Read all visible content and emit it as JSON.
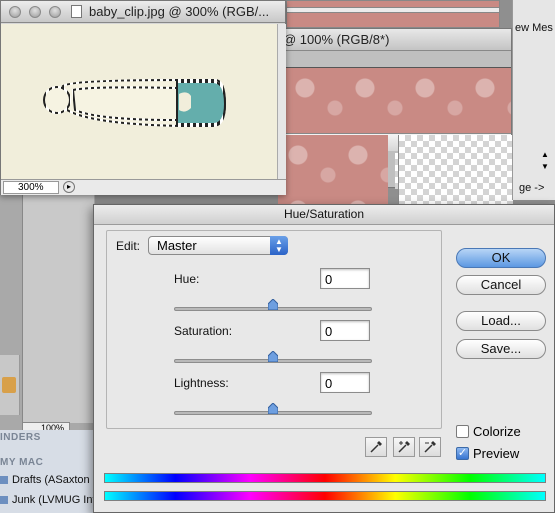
{
  "baby_window": {
    "title": "baby_clip.jpg @ 300% (RGB/...",
    "zoom": "300%"
  },
  "window_100": {
    "title": "@ 100% (RGB/8*)"
  },
  "top_right_panel": {
    "label_top": "ew Mes",
    "label_bottom": "ge ->"
  },
  "left_panel": {
    "zoom": "100%",
    "heading_finders": "INDERS",
    "heading_my_mac": "MY MAC",
    "mailboxes": [
      "Drafts (ASaxton",
      "Junk (LVMUG Inf"
    ]
  },
  "dialog": {
    "title": "Hue/Saturation",
    "edit_label": "Edit:",
    "edit_value": "Master",
    "sliders": [
      {
        "label": "Hue:",
        "value": "0",
        "level": 0.5
      },
      {
        "label": "Saturation:",
        "value": "0",
        "level": 0.5
      },
      {
        "label": "Lightness:",
        "value": "0",
        "level": 0.5
      }
    ],
    "buttons": {
      "ok": "OK",
      "cancel": "Cancel",
      "load": "Load...",
      "save": "Save..."
    },
    "colorize_label": "Colorize",
    "colorize_checked": false,
    "preview_label": "Preview",
    "preview_checked": true,
    "accent_color": "#5c98e2"
  }
}
